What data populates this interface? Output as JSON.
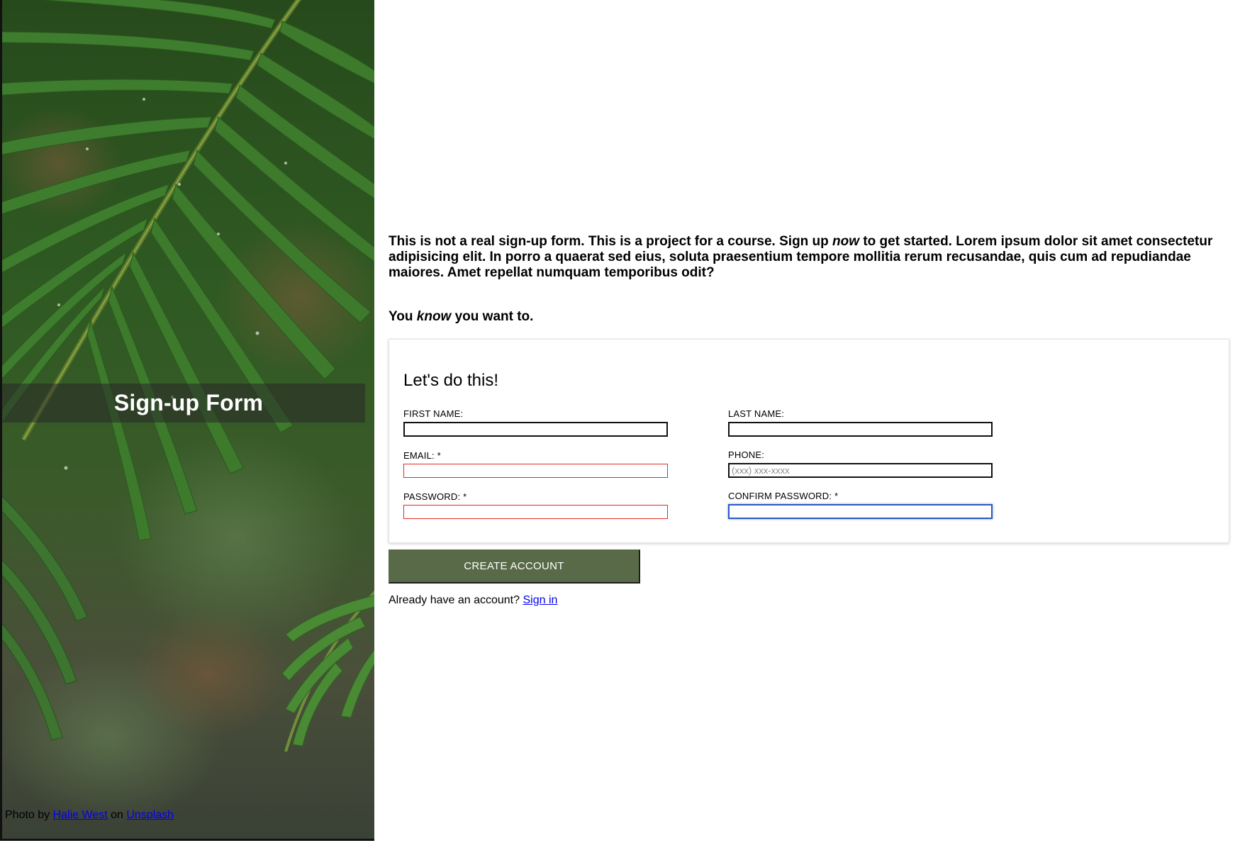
{
  "sidebar": {
    "banner_title": "Sign-up Form",
    "credit": {
      "prefix": "Photo by",
      "author_link": "Halie West",
      "middle": "on",
      "source_link": "Unsplash"
    }
  },
  "intro": {
    "part1": "This is not a real sign-up form. This is a project for a course. Sign up ",
    "emphasis": "now",
    "part2": " to get started. Lorem ipsum dolor sit amet consectetur adipisicing elit. In porro a quaerat sed eius, soluta praesentium tempore mollitia rerum recusandae, quis cum ad repudiandae maiores. Amet repellat numquam temporibus odit?"
  },
  "tagline": {
    "part1": "You ",
    "emphasis": "know",
    "part2": " you want to."
  },
  "form": {
    "heading": "Let's do this!",
    "fields": {
      "first_name": {
        "label": "FIRST NAME:",
        "value": "",
        "placeholder": ""
      },
      "last_name": {
        "label": "LAST NAME:",
        "value": "",
        "placeholder": ""
      },
      "email": {
        "label": "EMAIL: *",
        "value": "",
        "placeholder": ""
      },
      "phone": {
        "label": "PHONE:",
        "value": "",
        "placeholder": "(xxx) xxx-xxxx"
      },
      "password": {
        "label": "PASSWORD: *",
        "value": "",
        "placeholder": ""
      },
      "confirm_password": {
        "label": "CONFIRM PASSWORD: *",
        "value": "",
        "placeholder": ""
      }
    },
    "submit_label": "CREATE ACCOUNT",
    "signin_prompt": "Already have an account?",
    "signin_link": "Sign in"
  },
  "colors": {
    "button_bg": "#596a48",
    "invalid_border": "#e32b2b",
    "focus_border": "#2b5bbf",
    "link": "#0000ee"
  }
}
